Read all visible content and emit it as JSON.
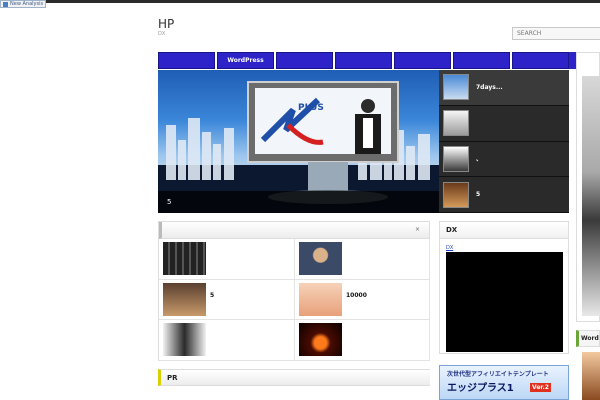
{
  "topbar": {
    "badge_label": "New Analysis"
  },
  "header": {
    "title": "HP",
    "tagline": "DX",
    "search_placeholder": "SEARCH"
  },
  "nav": {
    "items": [
      "",
      "WordPress",
      "",
      "",
      "",
      "",
      ""
    ]
  },
  "slider": {
    "caption": "5",
    "side_items": [
      "7days...",
      "",
      "、",
      "5"
    ]
  },
  "grid_panel": {
    "close_label": "×",
    "cells": [
      {
        "text": ""
      },
      {
        "text": ""
      },
      {
        "text": "5"
      },
      {
        "text": "10000"
      },
      {
        "text": ""
      },
      {
        "text": ""
      }
    ]
  },
  "pr_panel": {
    "title": "PR"
  },
  "dx_panel": {
    "title": "DX",
    "link": "DX"
  },
  "banner": {
    "line1": "次世代型アフィリエイトテンプレート",
    "line2": "エッジプラス1",
    "version": "Ver.2"
  },
  "right_sidebar": {
    "label": "Word"
  },
  "colors": {
    "nav": "#2d23c9",
    "accent_pr": "#d6d000"
  }
}
